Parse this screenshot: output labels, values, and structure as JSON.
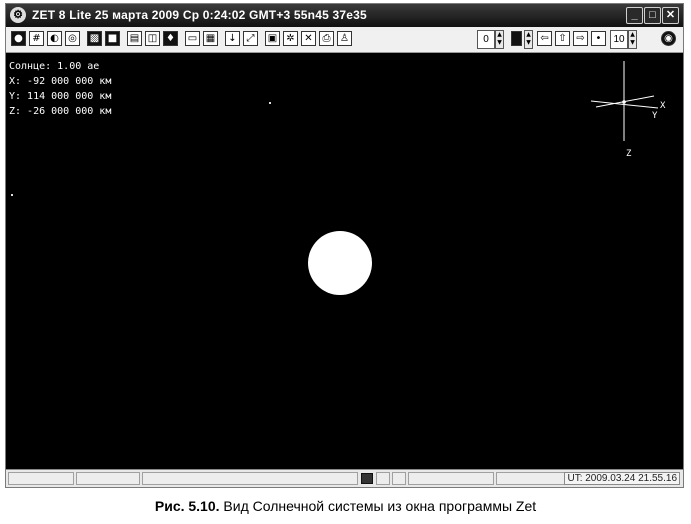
{
  "window": {
    "title": "ZET 8 Lite  25 марта 2009  Ср  0:24:02 GMT+3 55n45  37e35",
    "buttons": {
      "minimize": "_",
      "maximize": "□",
      "close": "✕"
    }
  },
  "toolbar": {
    "icons": [
      "sphere-icon",
      "grid-icon",
      "globe-icon",
      "orbit-icon",
      "image-icon",
      "map-icon",
      "film-icon",
      "camera-icon",
      "telescope-icon",
      "window-icon",
      "panel-icon",
      "download-icon",
      "zoom-icon",
      "document-icon",
      "settings-icon",
      "tools-icon",
      "printer-icon",
      "person-icon"
    ],
    "spin_left_value": "0",
    "spin_right_value": "10"
  },
  "viewport": {
    "readout": {
      "object": "Солнце: 1.00 ае",
      "x": "X: -92 000 000 км",
      "y": "Y: 114 000 000 км",
      "z": "Z: -26 000 000 км"
    },
    "axes": {
      "x": "X",
      "y": "Y",
      "z": "Z"
    }
  },
  "statusbar": {
    "ut": "UT: 2009.03.24 21.55.16"
  },
  "caption": {
    "label": "Рис. 5.10.",
    "text": " Вид Солнечной системы из окна программы Zet"
  }
}
